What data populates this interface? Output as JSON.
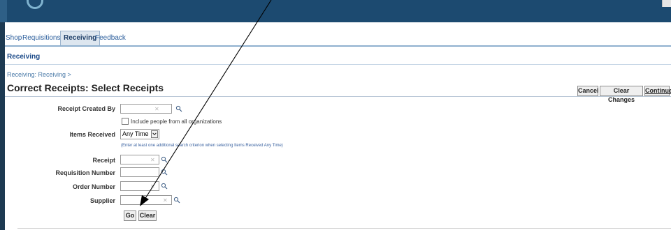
{
  "tabs": [
    "Shop",
    "Requisitions",
    "Receiving",
    "Feedback"
  ],
  "sub_tab": "Receiving",
  "breadcrumb": "Receiving: Receiving >",
  "page_title": "Correct Receipts: Select Receipts",
  "actions": {
    "cancel": "Cancel",
    "clear_changes": "Clear Changes",
    "continue": "Continue"
  },
  "form": {
    "receipt_created_by": {
      "label": "Receipt Created By",
      "value": ""
    },
    "include_orgs": {
      "label": "Include people from all organizations",
      "checked": false
    },
    "items_received": {
      "label": "Items Received",
      "value": "Any Time"
    },
    "hint": "(Enter at least one additional search criterion when selecting Items Received Any Time)",
    "receipt": {
      "label": "Receipt",
      "value": ""
    },
    "requisition_number": {
      "label": "Requisition Number",
      "value": ""
    },
    "order_number": {
      "label": "Order Number",
      "value": ""
    },
    "supplier": {
      "label": "Supplier",
      "value": ""
    }
  },
  "buttons": {
    "go": "Go",
    "clear": "Clear"
  },
  "icons": {
    "search": "search-icon",
    "clear": "clear-icon",
    "dropdown": "chevron-down-icon"
  }
}
